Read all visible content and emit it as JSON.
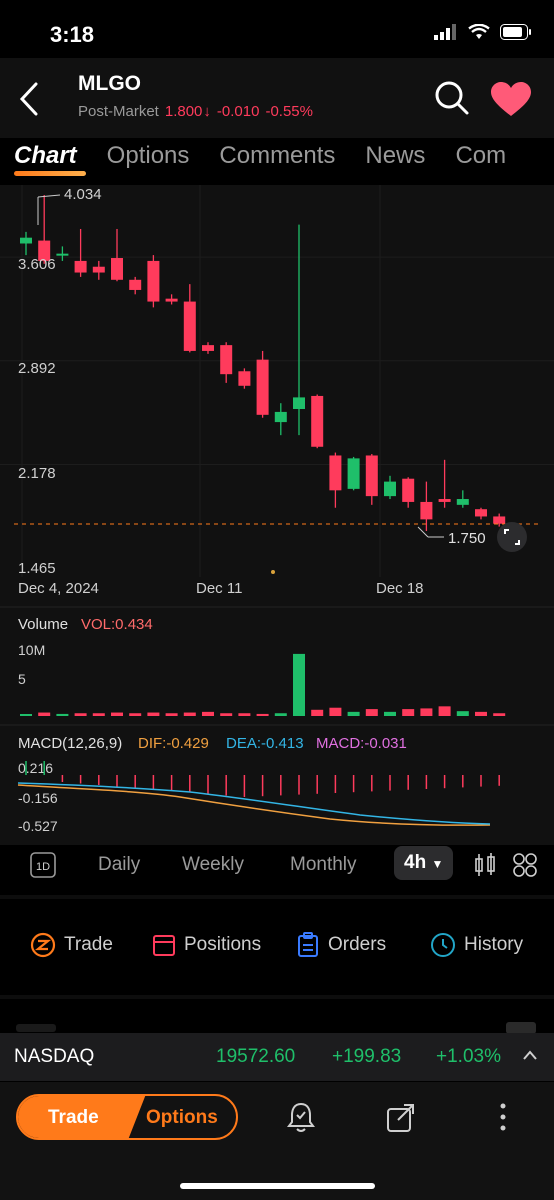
{
  "status": {
    "time": "3:18"
  },
  "header": {
    "ticker": "MLGO",
    "session_label": "Post-Market",
    "price": "1.800",
    "change": "-0.010",
    "change_pct": "-0.55%"
  },
  "tabs": [
    "Chart",
    "Options",
    "Comments",
    "News",
    "Com"
  ],
  "chart": {
    "price_labels": [
      "4.034",
      "3.606",
      "2.892",
      "2.178",
      "1.465"
    ],
    "last_marker": "1.750",
    "x_labels": [
      "Dec 4, 2024",
      "Dec 11",
      "Dec 18"
    ],
    "volume_title": "Volume",
    "volume_value": "VOL:0.434",
    "volume_ticks": [
      "10M",
      "5"
    ],
    "macd_title": "MACD(12,26,9)",
    "dif": "DIF:-0.429",
    "dea": "DEA:-0.413",
    "macd": "MACD:-0.031",
    "macd_ticks": [
      "0.216",
      "-0.156",
      "-0.527"
    ]
  },
  "chart_data": {
    "type": "candlestick",
    "price_range": [
      1.465,
      4.034
    ],
    "candles": [
      {
        "o": 3.7,
        "c": 3.74,
        "h": 3.78,
        "l": 3.62,
        "dir": "up"
      },
      {
        "o": 3.72,
        "c": 3.58,
        "h": 4.034,
        "l": 3.56,
        "dir": "down"
      },
      {
        "o": 3.62,
        "c": 3.63,
        "h": 3.68,
        "l": 3.58,
        "dir": "up"
      },
      {
        "o": 3.58,
        "c": 3.5,
        "h": 3.8,
        "l": 3.47,
        "dir": "down"
      },
      {
        "o": 3.54,
        "c": 3.5,
        "h": 3.58,
        "l": 3.45,
        "dir": "down"
      },
      {
        "o": 3.6,
        "c": 3.45,
        "h": 3.8,
        "l": 3.44,
        "dir": "down"
      },
      {
        "o": 3.45,
        "c": 3.38,
        "h": 3.47,
        "l": 3.35,
        "dir": "down"
      },
      {
        "o": 3.58,
        "c": 3.3,
        "h": 3.62,
        "l": 3.26,
        "dir": "down"
      },
      {
        "o": 3.32,
        "c": 3.3,
        "h": 3.35,
        "l": 3.28,
        "dir": "down"
      },
      {
        "o": 3.3,
        "c": 2.96,
        "h": 3.42,
        "l": 2.95,
        "dir": "down"
      },
      {
        "o": 3.0,
        "c": 2.96,
        "h": 3.02,
        "l": 2.94,
        "dir": "down"
      },
      {
        "o": 3.0,
        "c": 2.8,
        "h": 3.02,
        "l": 2.74,
        "dir": "down"
      },
      {
        "o": 2.82,
        "c": 2.72,
        "h": 2.84,
        "l": 2.7,
        "dir": "down"
      },
      {
        "o": 2.9,
        "c": 2.52,
        "h": 2.96,
        "l": 2.5,
        "dir": "down"
      },
      {
        "o": 2.47,
        "c": 2.54,
        "h": 2.6,
        "l": 2.38,
        "dir": "up"
      },
      {
        "o": 2.56,
        "c": 2.64,
        "h": 3.83,
        "l": 2.38,
        "dir": "up"
      },
      {
        "o": 2.65,
        "c": 2.3,
        "h": 2.66,
        "l": 2.29,
        "dir": "down"
      },
      {
        "o": 2.24,
        "c": 2.0,
        "h": 2.26,
        "l": 1.88,
        "dir": "down"
      },
      {
        "o": 2.01,
        "c": 2.22,
        "h": 2.23,
        "l": 2.0,
        "dir": "up"
      },
      {
        "o": 2.24,
        "c": 1.96,
        "h": 2.25,
        "l": 1.9,
        "dir": "down"
      },
      {
        "o": 1.96,
        "c": 2.06,
        "h": 2.1,
        "l": 1.94,
        "dir": "up"
      },
      {
        "o": 2.08,
        "c": 1.92,
        "h": 2.09,
        "l": 1.88,
        "dir": "down"
      },
      {
        "o": 1.92,
        "c": 1.8,
        "h": 2.06,
        "l": 1.72,
        "dir": "down"
      },
      {
        "o": 1.94,
        "c": 1.92,
        "h": 2.21,
        "l": 1.88,
        "dir": "down"
      },
      {
        "o": 1.9,
        "c": 1.94,
        "h": 2.0,
        "l": 1.88,
        "dir": "up"
      },
      {
        "o": 1.87,
        "c": 1.82,
        "h": 1.88,
        "l": 1.8,
        "dir": "down"
      },
      {
        "o": 1.82,
        "c": 1.77,
        "h": 1.84,
        "l": 1.75,
        "dir": "down"
      }
    ],
    "volume_max_m": 10,
    "volume_m": [
      0.2,
      0.5,
      0.3,
      0.4,
      0.4,
      0.5,
      0.4,
      0.5,
      0.4,
      0.5,
      0.6,
      0.4,
      0.4,
      0.3,
      0.4,
      9.0,
      0.9,
      1.2,
      0.6,
      1.0,
      0.6,
      1.0,
      1.1,
      1.4,
      0.7,
      0.6,
      0.4
    ],
    "macd_range": [
      -0.527,
      0.216
    ]
  },
  "periods": {
    "daily": "Daily",
    "weekly": "Weekly",
    "monthly": "Monthly",
    "active": "4h",
    "icon_1d": "1D"
  },
  "actions": {
    "trade": "Trade",
    "positions": "Positions",
    "orders": "Orders",
    "history": "History"
  },
  "index_bar": {
    "name": "NASDAQ",
    "value": "19572.60",
    "change": "+199.83",
    "change_pct": "+1.03%"
  },
  "bottom": {
    "trade": "Trade",
    "options": "Options"
  },
  "colors": {
    "up": "#1fbf6a",
    "down": "#ff3b5c",
    "accent": "#ff7a1a"
  }
}
